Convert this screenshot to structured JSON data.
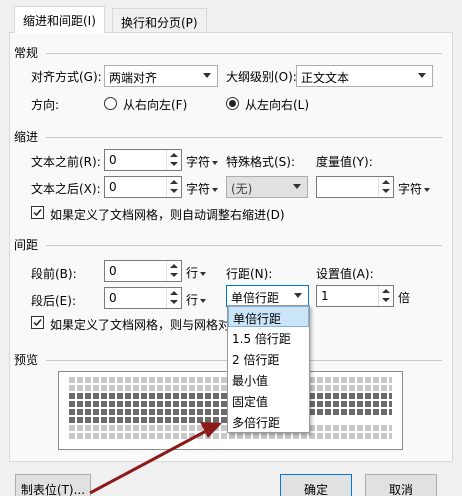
{
  "tabs": [
    {
      "label": "缩进和间距(I)",
      "active": true
    },
    {
      "label": "换行和分页(P)",
      "active": false
    }
  ],
  "general": {
    "title": "常规",
    "alignment_label": "对齐方式(G):",
    "alignment_value": "两端对齐",
    "outline_label": "大纲级别(O):",
    "outline_value": "正文文本",
    "direction_label": "方向:",
    "rtl_label": "从右向左(F)",
    "ltr_label": "从左向右(L)",
    "direction_selected": "ltr"
  },
  "indent": {
    "title": "缩进",
    "before_label": "文本之前(R):",
    "before_value": "0",
    "before_unit": "字符",
    "after_label": "文本之后(X):",
    "after_value": "0",
    "after_unit": "字符",
    "special_label": "特殊格式(S):",
    "special_value": "(无)",
    "measure_label": "度量值(Y):",
    "measure_value": "",
    "measure_unit": "字符",
    "grid_check_label": "如果定义了文档网格，则自动调整右缩进(D)",
    "grid_check_checked": true
  },
  "spacing": {
    "title": "间距",
    "before_label": "段前(B):",
    "before_value": "0",
    "before_unit": "行",
    "after_label": "段后(E):",
    "after_value": "0",
    "after_unit": "行",
    "line_label": "行距(N):",
    "line_value": "单倍行距",
    "setting_label": "设置值(A):",
    "setting_value": "1",
    "setting_unit": "倍",
    "grid_check_label": "如果定义了文档网格，则与网格对",
    "grid_check_checked": true
  },
  "line_spacing_options": [
    "单倍行距",
    "1.5 倍行距",
    "2 倍行距",
    "最小值",
    "固定值",
    "多倍行距"
  ],
  "preview": {
    "title": "预览"
  },
  "buttons": {
    "tabs_label": "制表位(T)...",
    "ok_label": "确定",
    "cancel_label": "取消"
  },
  "colors": {
    "annotation_arrow": "#8b1a1a",
    "selection_highlight": "#cce4f7",
    "default_button_border": "#0078d7"
  }
}
